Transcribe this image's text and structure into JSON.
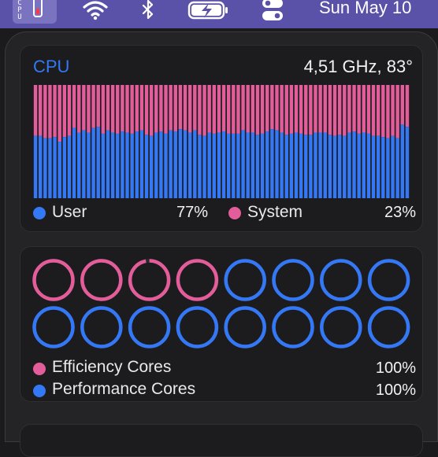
{
  "menubar": {
    "cpu_label": [
      "C",
      "P",
      "U"
    ],
    "cpu_level": 0.3,
    "date_text": "Sun May 10",
    "icons": [
      "cpu-monitor-icon",
      "wifi-icon",
      "bluetooth-icon",
      "battery-charging-icon",
      "control-center-icon"
    ],
    "background": "#5a51a9"
  },
  "cpu": {
    "title": "CPU",
    "freq_temp": "4,51 GHz, 83°",
    "legend": {
      "user_label": "User",
      "user_value": "77%",
      "system_label": "System",
      "system_value": "23%"
    },
    "colors": {
      "user": "#3478f6",
      "system": "#e35d9b",
      "empty": "#1f1f21"
    }
  },
  "chart_data": {
    "type": "bar",
    "stacked": true,
    "ylim": [
      0,
      100
    ],
    "series": [
      {
        "name": "User",
        "values": [
          55,
          55,
          53,
          53,
          54,
          50,
          54,
          55,
          62,
          58,
          60,
          58,
          62,
          63,
          57,
          60,
          58,
          57,
          59,
          58,
          57,
          59,
          60,
          56,
          55,
          58,
          59,
          57,
          60,
          59,
          61,
          60,
          58,
          60,
          56,
          55,
          58,
          57,
          58,
          59,
          57,
          57,
          57,
          60,
          58,
          58,
          56,
          57,
          59,
          61,
          60,
          58,
          56,
          57,
          58,
          57,
          56,
          56,
          58,
          58,
          58,
          56,
          55,
          56,
          55,
          58,
          59,
          57,
          58,
          57,
          55,
          55,
          54,
          53,
          55,
          53,
          65,
          63
        ]
      },
      {
        "name": "System",
        "values": [
          45,
          45,
          47,
          47,
          46,
          50,
          46,
          45,
          38,
          42,
          40,
          42,
          38,
          37,
          43,
          40,
          42,
          43,
          41,
          42,
          43,
          41,
          40,
          44,
          45,
          42,
          41,
          43,
          40,
          41,
          39,
          40,
          42,
          40,
          44,
          45,
          42,
          43,
          42,
          41,
          43,
          43,
          43,
          40,
          42,
          42,
          44,
          43,
          41,
          39,
          40,
          42,
          44,
          43,
          42,
          43,
          44,
          44,
          42,
          42,
          42,
          44,
          45,
          44,
          45,
          42,
          41,
          43,
          42,
          43,
          45,
          45,
          46,
          47,
          45,
          47,
          35,
          37
        ]
      }
    ]
  },
  "cores": {
    "efficiency_label": "Efficiency Cores",
    "efficiency_value": "100%",
    "performance_label": "Performance Cores",
    "performance_value": "100%",
    "efficiency_count": 4,
    "performance_count": 12,
    "efficiency_color": "#e35d9b",
    "performance_color": "#3478f6",
    "efficiency_loads": [
      1.0,
      1.0,
      0.97,
      1.0
    ],
    "performance_loads": [
      1,
      1,
      1,
      1,
      1,
      1,
      1,
      1,
      1,
      1,
      1,
      1
    ]
  }
}
